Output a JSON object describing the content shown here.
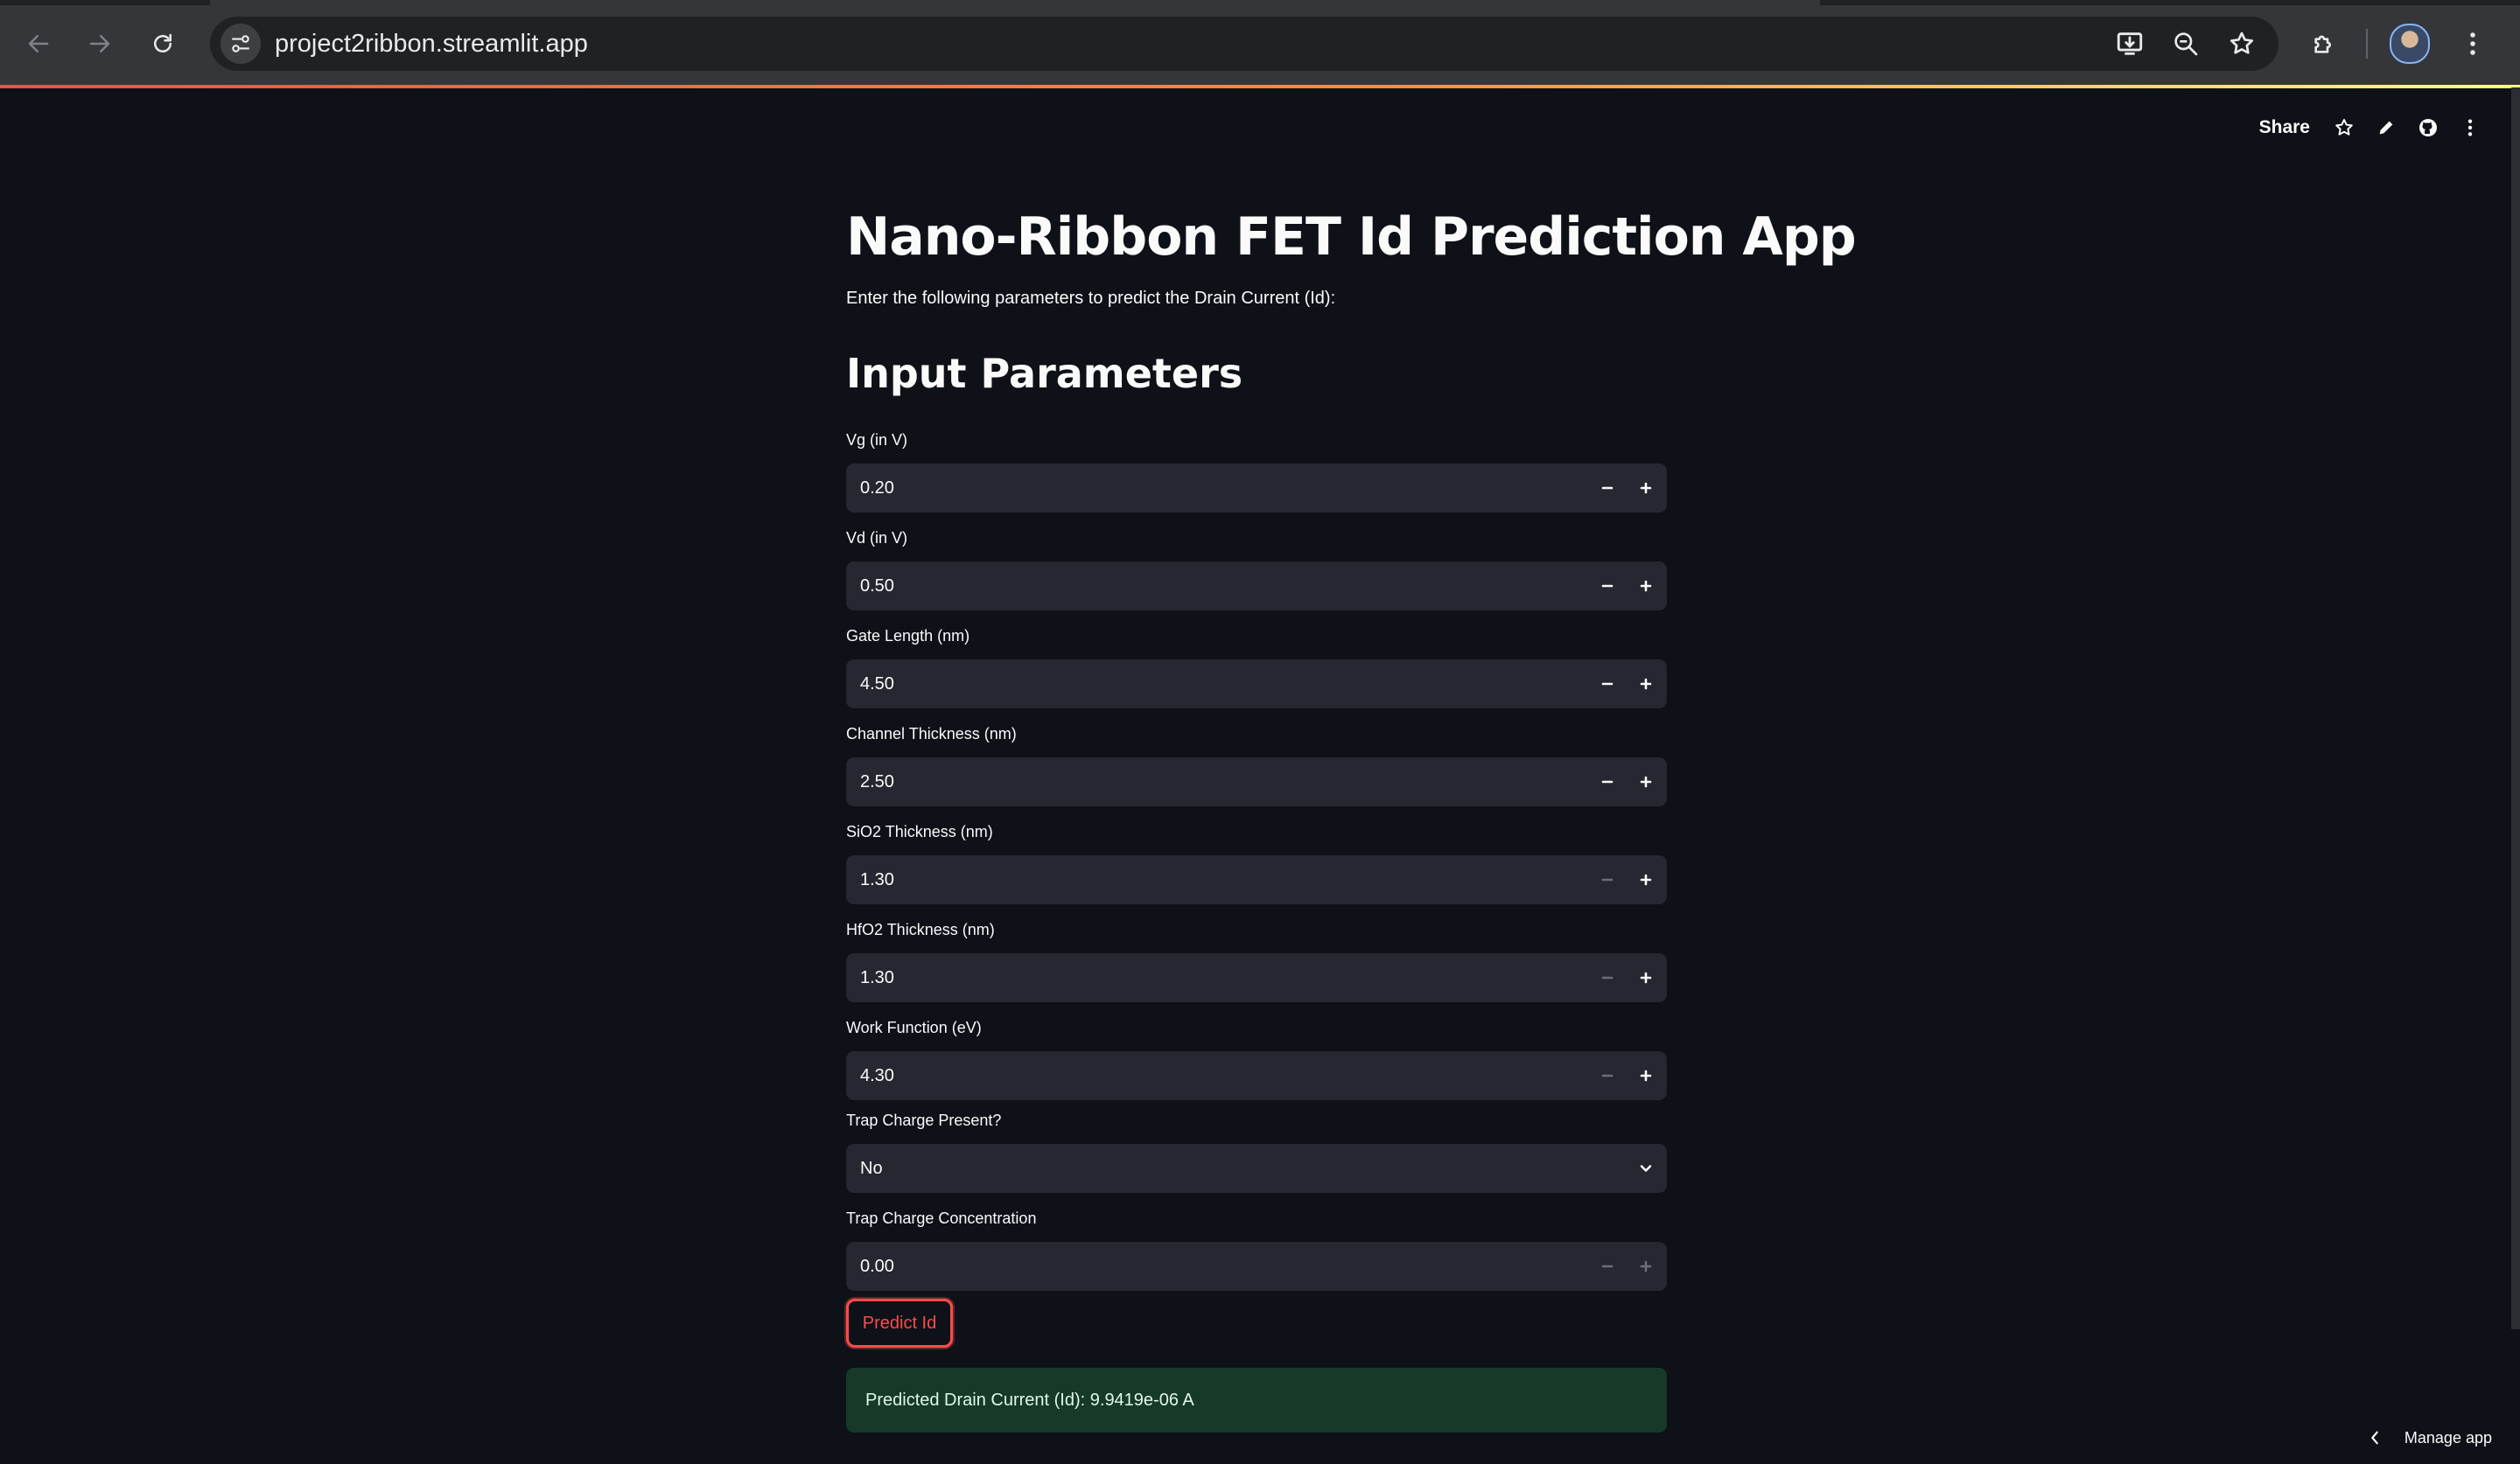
{
  "browser": {
    "url": "project2ribbon.streamlit.app",
    "icons": {
      "back": "back-arrow-icon",
      "forward": "forward-arrow-icon",
      "reload": "reload-icon",
      "site_info": "tune-icon",
      "install": "install-app-icon",
      "zoom": "zoom-out-icon",
      "bookmark": "star-icon",
      "extensions": "puzzle-icon",
      "profile": "avatar",
      "menu": "kebab-menu-icon"
    }
  },
  "streamlit_header": {
    "share_label": "Share",
    "icons": [
      "star-icon",
      "pencil-icon",
      "github-icon",
      "kebab-menu-icon"
    ]
  },
  "page": {
    "title": "Nano-Ribbon FET Id Prediction App",
    "intro": "Enter the following parameters to predict the Drain Current (Id):",
    "section_title": "Input Parameters"
  },
  "fields": [
    {
      "label": "Vg (in V)",
      "value": "0.20",
      "minus_enabled": true,
      "plus_enabled": true
    },
    {
      "label": "Vd (in V)",
      "value": "0.50",
      "minus_enabled": true,
      "plus_enabled": true
    },
    {
      "label": "Gate Length (nm)",
      "value": "4.50",
      "minus_enabled": true,
      "plus_enabled": true
    },
    {
      "label": "Channel Thickness (nm)",
      "value": "2.50",
      "minus_enabled": true,
      "plus_enabled": true
    },
    {
      "label": "SiO2 Thickness (nm)",
      "value": "1.30",
      "minus_enabled": false,
      "plus_enabled": true
    },
    {
      "label": "HfO2 Thickness (nm)",
      "value": "1.30",
      "minus_enabled": false,
      "plus_enabled": true
    },
    {
      "label": "Work Function (eV)",
      "value": "4.30",
      "minus_enabled": false,
      "plus_enabled": true
    }
  ],
  "trap_select": {
    "label": "Trap Charge Present?",
    "value": "No"
  },
  "trap_concentration": {
    "label": "Trap Charge Concentration",
    "value": "0.00",
    "minus_enabled": false,
    "plus_enabled": false
  },
  "predict_button": {
    "label": "Predict Id"
  },
  "result": {
    "text": "Predicted Drain Current (Id): 9.9419e-06 A"
  },
  "footer": {
    "manage_label": "Manage app"
  },
  "colors": {
    "background": "#0e1117",
    "input_bg": "#262730",
    "accent": "#ff4b4b",
    "success_bg": "#173928"
  }
}
